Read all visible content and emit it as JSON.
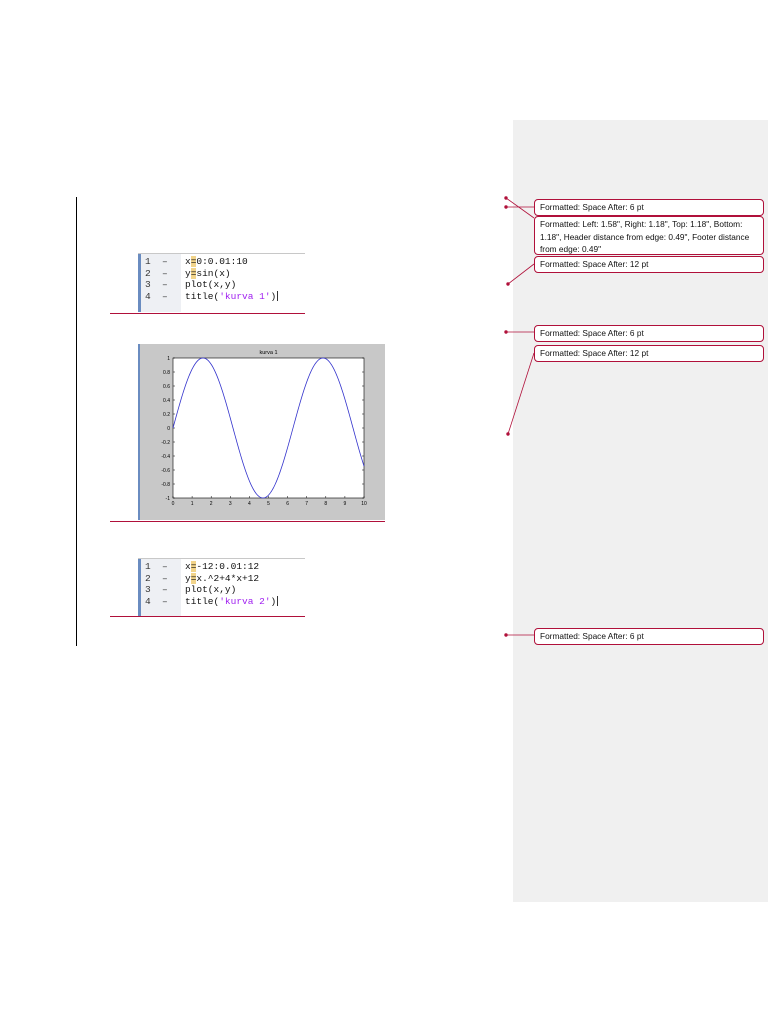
{
  "code_block_1": {
    "lines": [
      {
        "num": "1",
        "dash": "–",
        "pre": "x",
        "hl": "=",
        "post": "0:0.01:10",
        "str": ""
      },
      {
        "num": "2",
        "dash": "–",
        "pre": "y",
        "hl": "=",
        "post": "sin(x)",
        "str": ""
      },
      {
        "num": "3",
        "dash": "–",
        "pre": "plot(x,y)",
        "hl": "",
        "post": "",
        "str": ""
      },
      {
        "num": "4",
        "dash": "–",
        "pre": "title(",
        "hl": "",
        "post": ")",
        "str": "'kurva 1'"
      }
    ]
  },
  "chart_data": {
    "type": "line",
    "title": "kurva 1",
    "xlabel": "",
    "ylabel": "",
    "function": "y = sin(x)",
    "x_range": [
      0,
      10
    ],
    "step": 0.01,
    "xlim": [
      0,
      10
    ],
    "ylim": [
      -1,
      1
    ],
    "xticks": [
      "0",
      "1",
      "2",
      "3",
      "4",
      "5",
      "6",
      "7",
      "8",
      "9",
      "10"
    ],
    "yticks": [
      "1",
      "0.8",
      "0.6",
      "0.4",
      "0.2",
      "0",
      "-0.2",
      "-0.4",
      "-0.6",
      "-0.8",
      "-1"
    ],
    "series": [
      {
        "name": "sin(x)",
        "color": "#3333cc"
      }
    ],
    "grid": false
  },
  "code_block_2": {
    "lines": [
      {
        "num": "1",
        "dash": "–",
        "pre": "x",
        "hl": "=",
        "post": "-12:0.01:12",
        "str": ""
      },
      {
        "num": "2",
        "dash": "–",
        "pre": "y",
        "hl": "=",
        "post": "x.^2+4*x+12",
        "str": ""
      },
      {
        "num": "3",
        "dash": "–",
        "pre": "plot(x,y)",
        "hl": "",
        "post": "",
        "str": ""
      },
      {
        "num": "4",
        "dash": "–",
        "pre": "title(",
        "hl": "",
        "post": ")",
        "str": "'kurva 2'"
      }
    ]
  },
  "comments": [
    "Formatted: Space After:  6 pt",
    "Formatted: Left:  1.58\", Right:  1.18\", Top:  1.18\", Bottom:  1.18\", Header distance from edge:  0.49\", Footer distance from edge:  0.49\"",
    "Formatted: Space After:  12 pt",
    "Formatted: Space After:  6 pt",
    "Formatted: Space After:  12 pt",
    "Formatted: Space After:  6 pt"
  ],
  "colors": {
    "revision": "#b0103a",
    "pane": "#f0f0f0",
    "curve": "#3333cc"
  }
}
